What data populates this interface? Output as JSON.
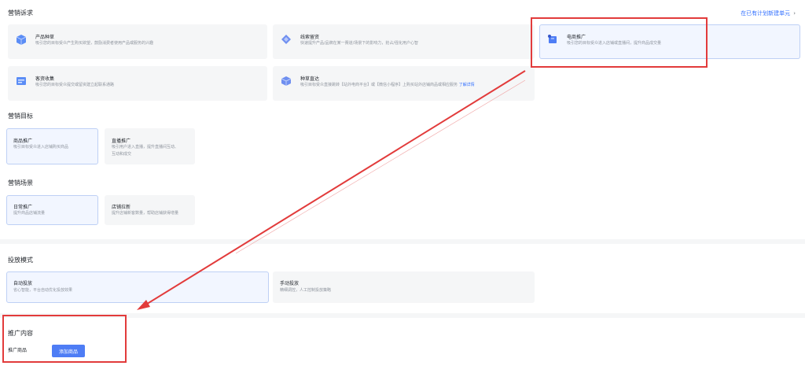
{
  "sections": {
    "marketing_demand": "营销诉求",
    "marketing_goal": "营销目标",
    "marketing_scene": "营销场景",
    "delivery_mode": "投放模式",
    "promo_content": "推广内容"
  },
  "top_link": {
    "label": "在已有计划新建单元",
    "chevron": "›"
  },
  "demand_cards": [
    {
      "title": "产品种草",
      "desc": "吸引您的目标受众产生购买欲望，鼓励消费者使用产品或服务的兴趣"
    },
    {
      "title": "线索留资",
      "desc": "快速提升产品/品牌在某一赛道/场景下的影响力，抢占/强化用户心智"
    },
    {
      "title": "电商推广",
      "desc": "吸引您的目标受众进入店铺或直播间，提升商品成交量"
    },
    {
      "title": "客资收集",
      "desc": "吸引您的目标受众提交或留资建立起联系通路"
    },
    {
      "title": "种草直达",
      "desc": "吸引目标受众直接跳转【站外电商平台】或【微信小程序】上购买站外店铺商品或相应服务",
      "link": "了解详情"
    }
  ],
  "goal_cards": [
    {
      "title": "商品推广",
      "desc": "吸引目标受众进入店铺购买商品"
    },
    {
      "title": "直播推广",
      "desc": "吸引用户进入直播，提升直播间互动、",
      "desc2": "互动和成交"
    }
  ],
  "scene_cards": [
    {
      "title": "日常推广",
      "desc": "提升商品店铺流量"
    },
    {
      "title": "店铺拉新",
      "desc": "提升店铺新客数量，帮助店铺获得增量"
    }
  ],
  "mode_cards": [
    {
      "title": "自动投放",
      "desc": "省心智能，平台自动优化投放效果"
    },
    {
      "title": "手动投放",
      "desc": "精细调控，人工控制投放策略"
    }
  ],
  "promo": {
    "label": "推广商品",
    "button": "添加商品"
  },
  "colors": {
    "accent": "#3370ff",
    "button": "#4e7df5",
    "annotation": "#e23b3b"
  }
}
